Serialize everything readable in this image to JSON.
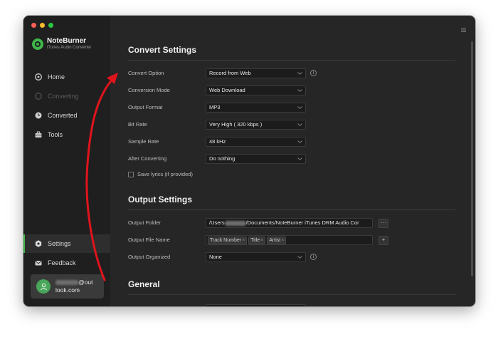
{
  "app": {
    "name": "NoteBurner",
    "subtitle": "iTunes Audio Converter"
  },
  "sidebar": {
    "home": "Home",
    "converting": "Converting",
    "converted": "Converted",
    "tools": "Tools",
    "settings": "Settings",
    "feedback": "Feedback",
    "account": {
      "line1_suffix": "@out",
      "line2": "look.com"
    }
  },
  "convert_settings": {
    "title": "Convert Settings",
    "convert_option": {
      "label": "Convert Option",
      "value": "Record from Web"
    },
    "conversion_mode": {
      "label": "Conversion Mode",
      "value": "Web Download"
    },
    "output_format": {
      "label": "Output Format",
      "value": "MP3"
    },
    "bit_rate": {
      "label": "Bit Rate",
      "value": "Very High ( 320 kbps )"
    },
    "sample_rate": {
      "label": "Sample Rate",
      "value": "48 kHz"
    },
    "after_converting": {
      "label": "After Converting",
      "value": "Do nothing"
    },
    "save_lyrics": {
      "label": "Save lyrics (if provided)",
      "checked": false
    }
  },
  "output_settings": {
    "title": "Output Settings",
    "output_folder": {
      "label": "Output Folder",
      "prefix": "/Users",
      "suffix": "/Documents/NoteBurner iTunes DRM Audio Cor",
      "browse": "···"
    },
    "output_file_name": {
      "label": "Output File Name",
      "tags": [
        "Track Number",
        "Title",
        "Artist"
      ],
      "add": "+"
    },
    "output_organized": {
      "label": "Output Organized",
      "value": "None"
    }
  },
  "general": {
    "title": "General"
  },
  "colors": {
    "accent": "#3fb64a",
    "annotation_arrow": "#e0141c"
  }
}
